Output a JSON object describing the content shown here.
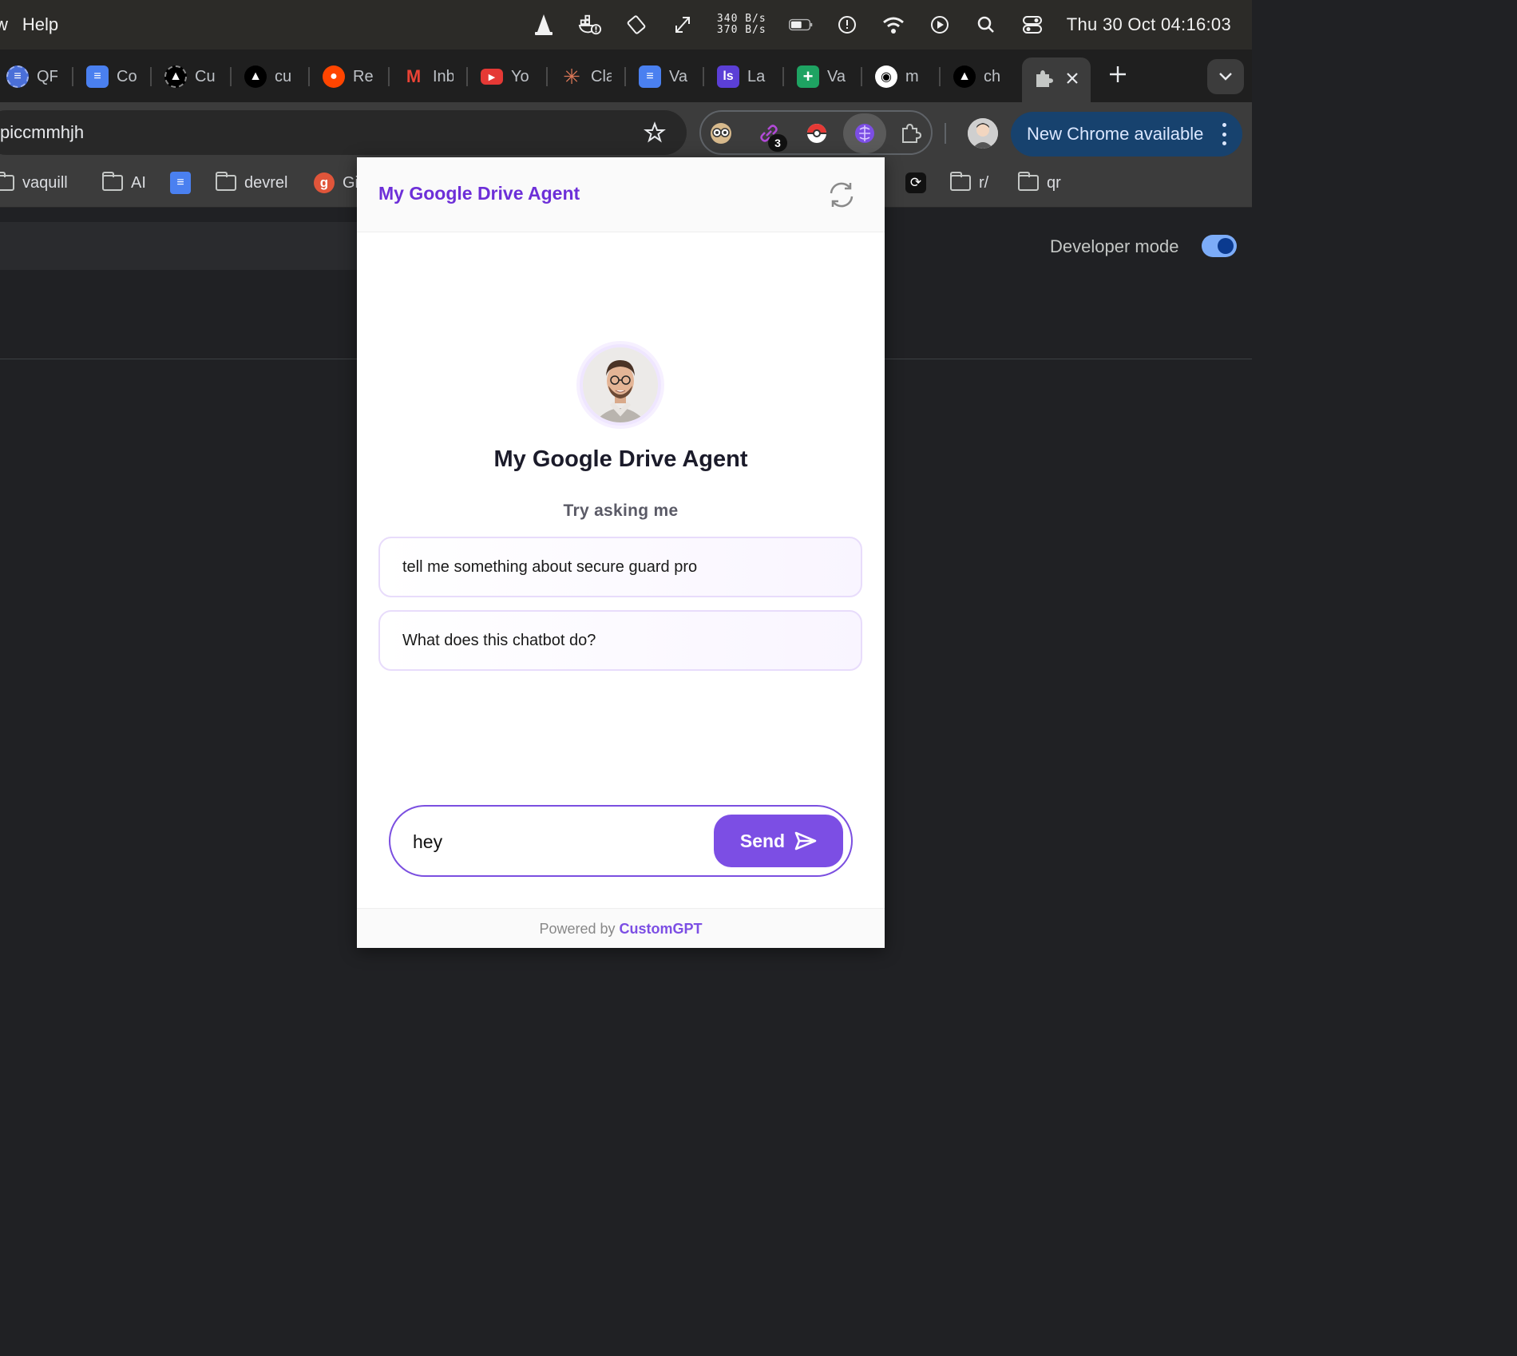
{
  "menubar": {
    "left_items": [
      "w",
      "Help"
    ],
    "net_up": "340 B/s",
    "net_down": "370 B/s",
    "clock": "Thu 30 Oct  04:16:03",
    "status_icons": [
      "vlc-icon",
      "docker-icon",
      "screen-rotate-icon",
      "resize-icon",
      "battery-icon",
      "time-machine-icon",
      "wifi-icon",
      "play-icon",
      "spotlight-icon",
      "control-center-icon"
    ]
  },
  "tabs": [
    {
      "label": "QF",
      "icon": "qf-icon",
      "color": "#4a6fd8"
    },
    {
      "label": "Co",
      "icon": "docs-icon",
      "color": "#4a80f0"
    },
    {
      "label": "Cu",
      "icon": "triangle-logo-icon",
      "color": "#000000"
    },
    {
      "label": "cu",
      "icon": "triangle-logo-icon",
      "color": "#000000"
    },
    {
      "label": "Re",
      "icon": "reddit-icon",
      "color": "#ff4500"
    },
    {
      "label": "Inb",
      "icon": "gmail-icon",
      "color": "#ea4335"
    },
    {
      "label": "Yo",
      "icon": "youtube-icon",
      "color": "#e53935"
    },
    {
      "label": "Cla",
      "icon": "claude-icon",
      "color": "#d97757"
    },
    {
      "label": "Va",
      "icon": "docs-icon",
      "color": "#4a80f0"
    },
    {
      "label": "La",
      "icon": "lovable-icon",
      "color": "#5b3fd6"
    },
    {
      "label": "Va",
      "icon": "sheets-icon",
      "color": "#1ea362"
    },
    {
      "label": "m",
      "icon": "github-icon",
      "color": "#ffffff"
    },
    {
      "label": "ch",
      "icon": "triangle-logo-icon",
      "color": "#000000"
    }
  ],
  "toolbar": {
    "url": "piccmmhjh",
    "extensions_badge": "3",
    "update_label": "New Chrome available"
  },
  "bookmarks": [
    {
      "label": "vaquill",
      "type": "folder"
    },
    {
      "label": "AI",
      "type": "folder"
    },
    {
      "label": "",
      "type": "docs"
    },
    {
      "label": "devrel",
      "type": "folder"
    },
    {
      "label": "Gi",
      "type": "g-logo"
    },
    {
      "label": "",
      "type": "sync"
    },
    {
      "label": "r/",
      "type": "folder"
    },
    {
      "label": "qr",
      "type": "folder"
    }
  ],
  "page": {
    "developer_mode_label": "Developer mode",
    "developer_mode_on": true
  },
  "popup": {
    "header_title": "My Google Drive Agent",
    "agent_name": "My Google Drive Agent",
    "try_label": "Try asking me",
    "suggestions": [
      "tell me something about secure guard pro",
      "What does this chatbot do?"
    ],
    "input_value": "hey",
    "send_label": "Send",
    "footer_prefix": "Powered by",
    "footer_brand": "CustomGPT",
    "accent_color": "#7c4ee4"
  }
}
